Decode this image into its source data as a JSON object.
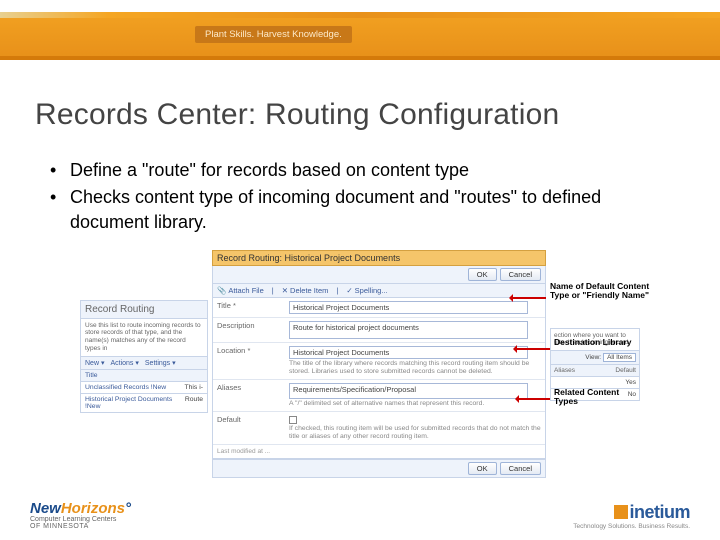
{
  "banner_tag": "Plant Skills. Harvest Knowledge.",
  "slide_title": "Records Center: Routing Configuration",
  "bullets": [
    "Define a \"route\" for records based on content type",
    "Checks content type of incoming document and \"routes\" to defined document library."
  ],
  "screenshot": {
    "header": "Record Routing: Historical Project Documents",
    "buttons": {
      "ok": "OK",
      "cancel": "Cancel"
    },
    "cmdbar": {
      "attach": "Attach File",
      "delete": "Delete Item",
      "spelling": "Spelling..."
    },
    "fields": {
      "title_label": "Title *",
      "title_value": "Historical Project Documents",
      "desc_label": "Description",
      "desc_value": "Route for historical project documents",
      "location_label": "Location *",
      "location_value": "Historical Project Documents",
      "location_hint": "The title of the library where records matching this record routing item should be stored. Libraries used to store submitted records cannot be deleted.",
      "aliases_label": "Aliases",
      "aliases_value": "Requirements/Specification/Proposal",
      "aliases_hint": "A \"/\" delimited set of alternative names that represent this record.",
      "default_label": "Default",
      "default_hint": "If checked, this routing item will be used for submitted records that do not match the title or aliases of any other record routing item.",
      "footer_text": "Last modified at ..."
    },
    "left_panel": {
      "title": "Record Routing",
      "desc": "Use this list to route incoming records to store records of that type, and the name(s) matches any of the record types in",
      "bar": {
        "new": "New ▾",
        "actions": "Actions ▾",
        "settings": "Settings ▾"
      },
      "col_title": "Title",
      "rows": [
        {
          "title": "Unclassified Records !New",
          "val": "This i-"
        },
        {
          "title": "Historical Project Documents !New",
          "val": "Route"
        }
      ]
    },
    "right": {
      "desc": "ection where you want to ults. If an incoming record",
      "view_label": "View:",
      "view_value": "All Items",
      "hdr_aliases": "Aliases",
      "hdr_default": "Default",
      "rows": [
        {
          "aliases": "",
          "default": "Yes"
        },
        {
          "aliases": "",
          "default": "No"
        }
      ]
    }
  },
  "annotations": {
    "a1": "Name of Default Content Type or \"Friendly Name\"",
    "a2": "Destination Library",
    "a3": "Related Content Types"
  },
  "footer": {
    "left_main_1": "New",
    "left_main_2": "Horizons",
    "left_sub1": "Computer Learning Centers",
    "left_sub2": "OF MINNESOTA",
    "right_brand": "inetium",
    "right_tag": "Technology Solutions. Business Results."
  }
}
